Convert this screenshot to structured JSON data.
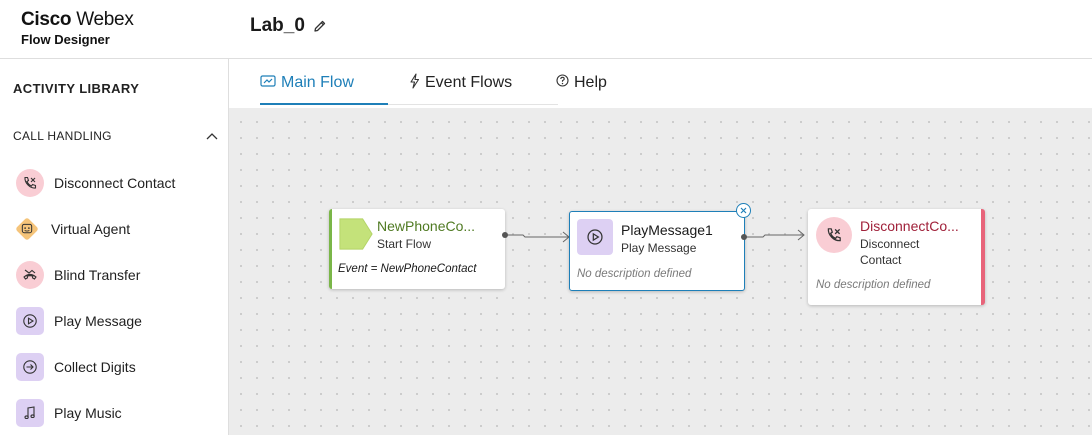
{
  "brand": {
    "name_bold": "Cisco",
    "name_light": "Webex",
    "product": "Flow Designer"
  },
  "flow": {
    "title": "Lab_0",
    "edit_icon": "pencil-icon"
  },
  "sidebar": {
    "title": "ACTIVITY LIBRARY",
    "section": {
      "title": "CALL HANDLING",
      "toggle_icon": "chevron-up-icon"
    },
    "items": [
      {
        "label": "Disconnect Contact",
        "icon": "phone-disconnect-icon",
        "color": "#f9cdd4"
      },
      {
        "label": "Virtual Agent",
        "icon": "bot-icon",
        "color": "#f5c47a"
      },
      {
        "label": "Blind Transfer",
        "icon": "blind-transfer-icon",
        "color": "#f9cdd4"
      },
      {
        "label": "Play Message",
        "icon": "play-circle-icon",
        "color": "#ddd0f3"
      },
      {
        "label": "Collect Digits",
        "icon": "arrow-circle-icon",
        "color": "#ddd0f3"
      },
      {
        "label": "Play Music",
        "icon": "music-note-icon",
        "color": "#ddd0f3"
      }
    ]
  },
  "tabs": [
    {
      "label": "Main Flow",
      "icon": "flow-icon",
      "active": true
    },
    {
      "label": "Event Flows",
      "icon": "lightning-icon",
      "active": false
    },
    {
      "label": "Help",
      "icon": "help-circle-icon",
      "active": false
    }
  ],
  "nodes": {
    "start": {
      "title": "NewPhoneCo...",
      "subtitle": "Start Flow",
      "event": "Event = NewPhoneContact",
      "color": "#7ab648"
    },
    "play": {
      "title": "PlayMessage1",
      "subtitle": "Play Message",
      "description": "No description defined",
      "color": "#1e7fb8"
    },
    "disconnect": {
      "title": "DisconnectCo...",
      "subtitle_line1": "Disconnect",
      "subtitle_line2": "Contact",
      "description": "No description defined",
      "color": "#e8647a"
    }
  }
}
